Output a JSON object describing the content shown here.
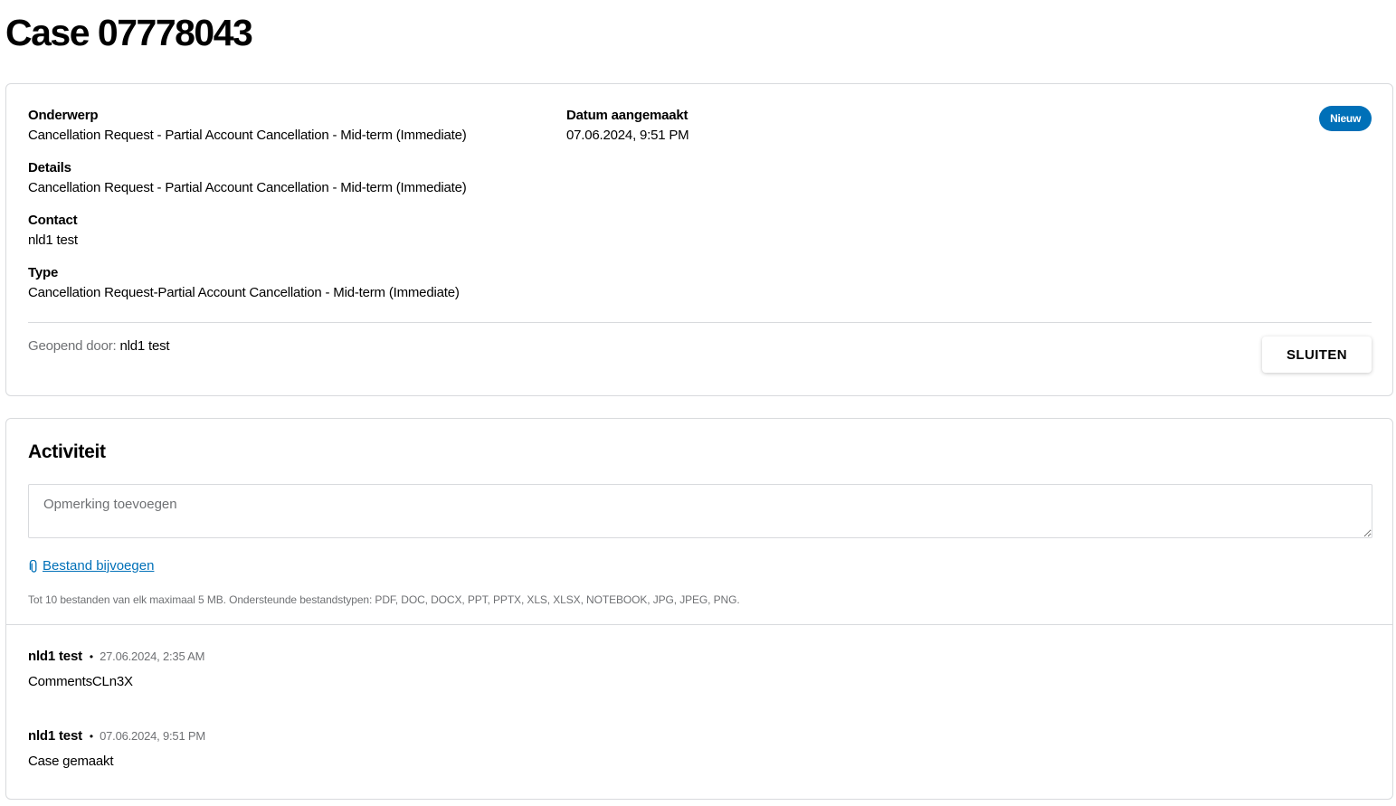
{
  "page": {
    "title": "Case 07778043"
  },
  "details": {
    "subject_label": "Onderwerp",
    "subject_value": "Cancellation Request - Partial Account Cancellation - Mid-term (Immediate)",
    "details_label": "Details",
    "details_value": "Cancellation Request - Partial Account Cancellation - Mid-term (Immediate)",
    "contact_label": "Contact",
    "contact_value": "nld1 test",
    "type_label": "Type",
    "type_value": "Cancellation Request-Partial Account Cancellation - Mid-term (Immediate)",
    "created_label": "Datum aangemaakt",
    "created_value": "07.06.2024, 9:51 PM",
    "status_badge": "Nieuw",
    "opened_by_label": "Geopend door:",
    "opened_by_value": "nld1 test",
    "close_button": "SLUITEN"
  },
  "activity": {
    "title": "Activiteit",
    "comment_placeholder": "Opmerking toevoegen",
    "attach_icon": "paperclip-icon",
    "attach_label": "Bestand bijvoegen",
    "file_hint": "Tot 10 bestanden van elk maximaal 5 MB. Ondersteunde bestandstypen: PDF, DOC, DOCX, PPT, PPTX, XLS, XLSX, NOTEBOOK, JPG, JPEG, PNG.",
    "entries": [
      {
        "author": "nld1 test",
        "separator": "•",
        "timestamp": "27.06.2024, 2:35 AM",
        "text": "CommentsCLn3X"
      },
      {
        "author": "nld1 test",
        "separator": "•",
        "timestamp": "07.06.2024, 9:51 PM",
        "text": "Case gemaakt"
      }
    ]
  },
  "colors": {
    "accent": "#0070b8",
    "border": "#d8dadd",
    "muted_text": "#6f7174"
  }
}
